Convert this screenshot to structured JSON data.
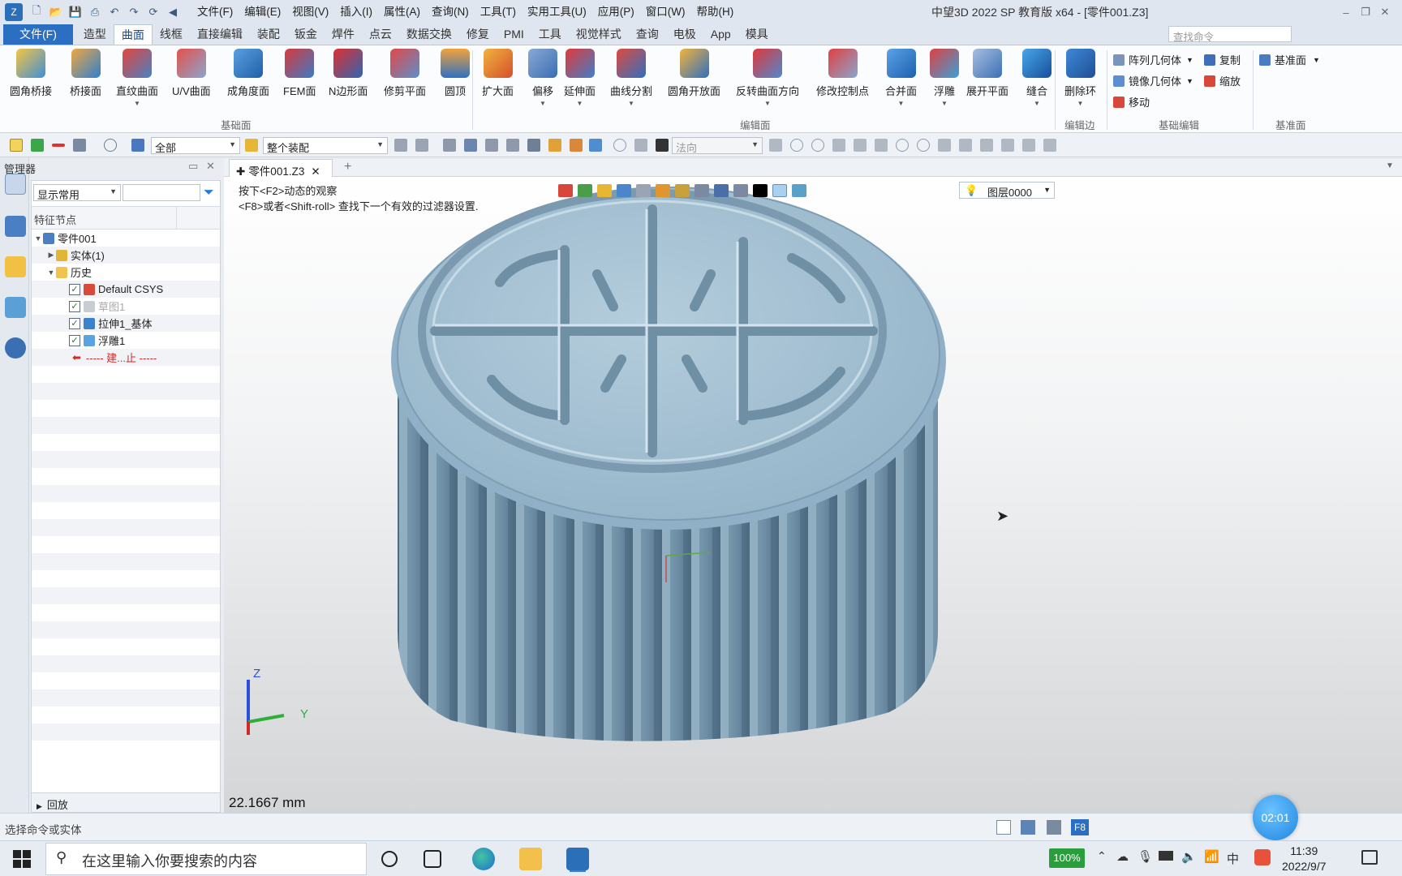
{
  "title_bar": {
    "menus": [
      "文件(F)",
      "编辑(E)",
      "视图(V)",
      "插入(I)",
      "属性(A)",
      "查询(N)",
      "工具(T)",
      "实用工具(U)",
      "应用(P)",
      "窗口(W)",
      "帮助(H)"
    ],
    "window_title": "中望3D 2022 SP 教育版 x64 - [零件001.Z3]"
  },
  "ribbon_tabs": {
    "file": "文件(F)",
    "tabs": [
      "造型",
      "曲面",
      "线框",
      "直接编辑",
      "装配",
      "钣金",
      "焊件",
      "点云",
      "数据交换",
      "修复",
      "PMI",
      "工具",
      "视觉样式",
      "查询",
      "电极",
      "App",
      "模具"
    ],
    "active": "曲面",
    "search_placeholder": "查找命令"
  },
  "ribbon": {
    "basic_surface_buttons": [
      "圆角桥接",
      "桥接面",
      "直纹曲面",
      "U/V曲面",
      "成角度面",
      "FEM面",
      "N边形面",
      "修剪平面",
      "圆顶"
    ],
    "edit_surface_buttons": [
      "扩大面",
      "偏移",
      "延伸面",
      "曲线分割",
      "圆角开放面",
      "反转曲面方向",
      "修改控制点",
      "合并面",
      "浮雕",
      "展开平面",
      "缝合"
    ],
    "edit_edge_button": "删除环",
    "basic_edit": [
      "阵列几何体",
      "复制",
      "镜像几何体",
      "缩放",
      "移动"
    ],
    "datum": "基准面",
    "groups": [
      "基础面",
      "编辑面",
      "编辑边",
      "基础编辑",
      "基准面"
    ]
  },
  "toolbar2": {
    "filter": "全部",
    "scope": "整个装配",
    "direction": "法向"
  },
  "manager": {
    "title": "管理器",
    "display_filter": "显示常用",
    "tree_header": "特征节点",
    "tree": {
      "root": "零件001",
      "solid": "实体(1)",
      "history": "历史",
      "items": [
        "Default CSYS",
        "草图1",
        "拉伸1_基体",
        "浮雕1"
      ],
      "stop": "----- 建...止 -----"
    },
    "playback": "回放"
  },
  "document": {
    "tab": "零件001.Z3",
    "hint_line1": "按下<F2>动态的观察",
    "hint_line2": "<F8>或者<Shift-roll> 查找下一个有效的过滤器设置.",
    "layer": "图层0000",
    "scale": "22.1667 mm",
    "axis_z": "Z",
    "axis_y": "Y"
  },
  "status": {
    "text": "选择命令或实体",
    "f8": "F8",
    "timer": "02:01"
  },
  "taskbar": {
    "search_placeholder": "在这里输入你要搜索的内容",
    "battery": "100%",
    "time": "11:39",
    "date": "2022/9/7",
    "ime": "中"
  },
  "colors": {
    "model": "#8fb0c6",
    "accent": "#2b6fc2"
  }
}
